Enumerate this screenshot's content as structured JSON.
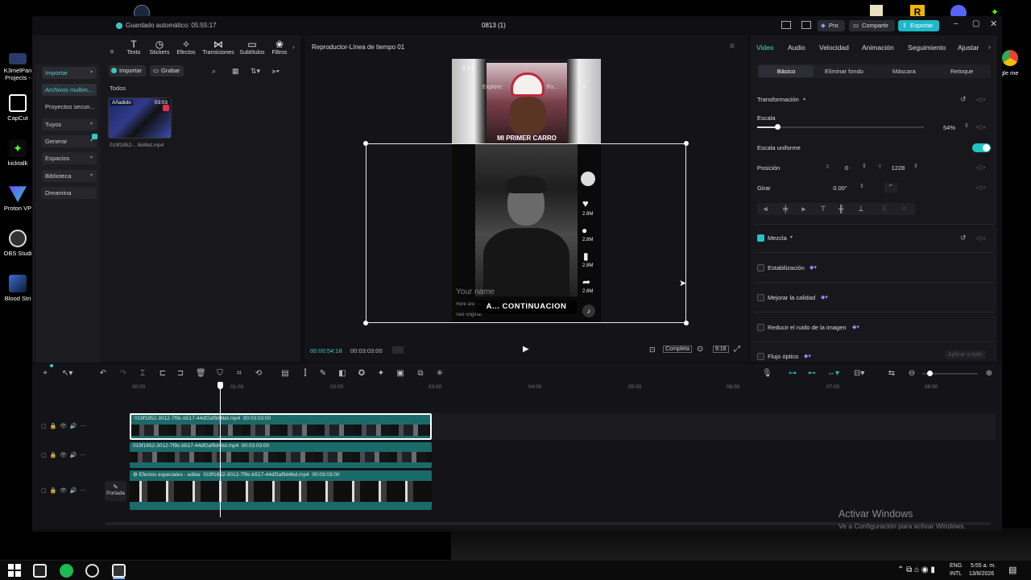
{
  "window": {
    "title": "0813 (1)",
    "autosave": "Guardado automático: 05:55:17",
    "pro_label": "Pro",
    "share_label": "Compartir",
    "export_label": "Exportar"
  },
  "desktop_icons": [
    {
      "label": "K3melPan Projects -",
      "color": "#2a3a6a"
    },
    {
      "label": "CapCut",
      "color": "#ffffff"
    },
    {
      "label": "kicktalk",
      "color": "#1c3a1c"
    },
    {
      "label": "Proton VP",
      "color": "#5b3cc4"
    },
    {
      "label": "OBS Studi",
      "color": "#333333"
    },
    {
      "label": "Blood Stri",
      "color": "#2b4d7a"
    }
  ],
  "right_desktop_label": "gle me",
  "toolbar": {
    "tools": [
      {
        "icon": "text-icon",
        "glyph": "T",
        "label": "Texto"
      },
      {
        "icon": "sticker-icon",
        "glyph": "◷",
        "label": "Stickers"
      },
      {
        "icon": "effects-icon",
        "glyph": "✧",
        "label": "Efectos"
      },
      {
        "icon": "transitions-icon",
        "glyph": "⋈",
        "label": "Transiciones"
      },
      {
        "icon": "subtitles-icon",
        "glyph": "▭",
        "label": "Subtítulos"
      },
      {
        "icon": "filters-icon",
        "glyph": "❀",
        "label": "Filtros"
      }
    ],
    "truncated_left": "o"
  },
  "sidebar": {
    "items": [
      {
        "label": "Importar",
        "active": true
      },
      {
        "label": "Archivos multim...",
        "active": true
      },
      {
        "label": "Proyectos secun..."
      },
      {
        "label": "Tuyos"
      },
      {
        "label": "Generar"
      },
      {
        "label": "Espacios"
      },
      {
        "label": "Biblioteca"
      },
      {
        "label": "Dreamina"
      }
    ]
  },
  "media": {
    "import_label": "Importar",
    "record_label": "Grabar",
    "filter_all": "Todos",
    "thumb_badge": "Añadido",
    "thumb_duration": "03:03",
    "thumb_name": "019f1852-...9d4bd.mp4"
  },
  "player": {
    "title": "Reproductor-Línea de tiempo 01",
    "current_time": "00:00:54:18",
    "total_time": "00:03:03:00",
    "view_mode": "Completa",
    "ratio": "9:16",
    "overlay": {
      "status_time": "9:41",
      "explore": "Explore",
      "following": "Fo...",
      "top_text": "MI PRIMER CARRO",
      "username": "Your name",
      "desc": "Here are so...",
      "see_original": "See original",
      "caption": "A... CONTINUACION",
      "counts": [
        "2.8M",
        "2.8M",
        "2.8M",
        "2.8M"
      ]
    }
  },
  "inspector": {
    "tabs": [
      "Video",
      "Audio",
      "Velocidad",
      "Animación",
      "Seguimiento",
      "Ajustar"
    ],
    "subtabs": [
      "Básico",
      "Eliminar fondo",
      "Máscara",
      "Retoque"
    ],
    "transform_label": "Transformación",
    "scale_label": "Escala",
    "scale_value": "54%",
    "scale_fraction": 0.12,
    "uniform_label": "Escala uniforme",
    "position_label": "Posición",
    "x_label": "X",
    "x_value": "0",
    "y_label": "Y",
    "y_value": "1228",
    "rotate_label": "Girar",
    "rotate_value": "0.00°",
    "blend_label": "Mezcla",
    "stabilize_label": "Estabilización",
    "enhance_label": "Mejorar la calidad",
    "denoise_label": "Reducir el ruido de la imagen",
    "optical_label": "Flujo óptico",
    "apply_all": "Aplicar a todo"
  },
  "timeline": {
    "ruler": [
      "00:00",
      "01:00",
      "02:00",
      "03:00",
      "04:00",
      "05:00",
      "06:00",
      "07:00",
      "08:00"
    ],
    "cover_label": "Portada",
    "clips": [
      {
        "name": "019f1852-3012-7f9c-b517-44df2af9d4bd.mp4",
        "duration": "00:03:03:00"
      },
      {
        "name": "019f1852-3012-7f9c-b517-44df2af9d4bd.mp4",
        "duration": "00:03:03:00"
      },
      {
        "name": "Efectos especiales - editar",
        "name2": "019f1852-3012-7f9c-b517-44df2af9d4bd.mp4",
        "duration": "00:03:03:00"
      }
    ]
  },
  "watermark": {
    "title": "Activar Windows",
    "subtitle": "Ve a Configuración para activar Windows."
  },
  "taskbar": {
    "lang1": "ENG",
    "lang2": "INTL",
    "time": "5:55 a. m.",
    "date": "13/8/2026"
  }
}
